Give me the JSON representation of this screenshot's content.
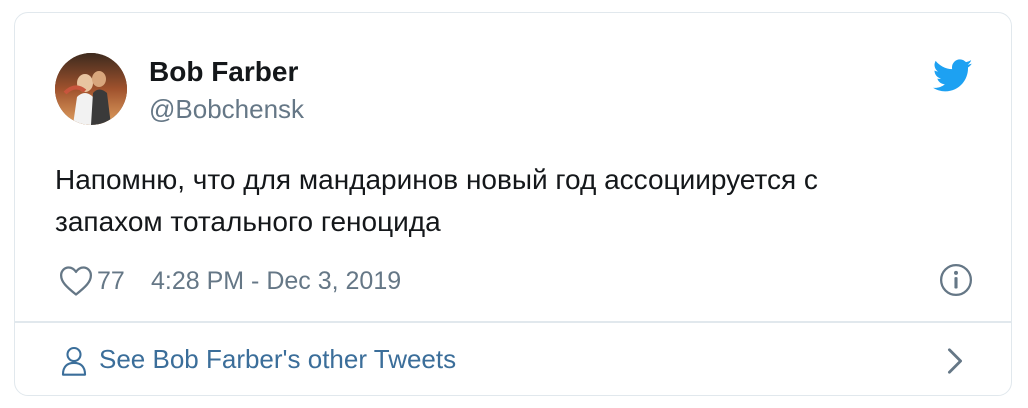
{
  "tweet": {
    "user": {
      "name": "Bob Farber",
      "handle": "@Bobchensk"
    },
    "text_lines": [
      "Напомню, что для мандаринов новый год ассоциируется с",
      "запахом тотального геноцида"
    ],
    "likes": "77",
    "timestamp": "4:28 PM - Dec 3, 2019"
  },
  "footer": {
    "label": "See Bob Farber's other Tweets"
  },
  "icons": {
    "brand": "twitter-bird-icon",
    "like": "heart-icon",
    "info": "info-icon",
    "person": "person-icon",
    "chevron": "chevron-right-icon"
  },
  "colors": {
    "twitter_blue": "#1da1f2",
    "link_blue": "#3b6e9a",
    "secondary_text": "#657786",
    "primary_text": "#14171a",
    "border": "#e1e8ed"
  }
}
